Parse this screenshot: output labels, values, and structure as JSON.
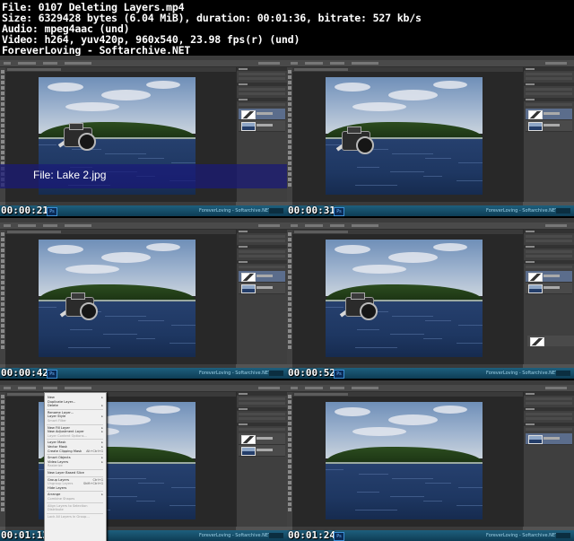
{
  "header": {
    "lines": [
      "File: 0107 Deleting Layers.mp4",
      "Size: 6329428 bytes (6.04 MiB), duration: 00:01:36, bitrate: 527 kb/s",
      "Audio: mpeg4aac (und)",
      "Video: h264, yuv420p, 960x540, 23.98 fps(r) (und)",
      "ForeverLoving - Softarchive.NET"
    ]
  },
  "taskbar_label": "ForeverLoving - Softarchive.NET",
  "ps_icon": "Ps",
  "frames": [
    {
      "timestamp": "00:00:21",
      "banner": "File: Lake 2.jpg"
    },
    {
      "timestamp": "00:00:31"
    },
    {
      "timestamp": "00:00:42"
    },
    {
      "timestamp": "00:00:52"
    },
    {
      "timestamp": "00:01:13"
    },
    {
      "timestamp": "00:01:24"
    }
  ],
  "context_menu": {
    "items": [
      {
        "label": "New",
        "disabled": false,
        "sub": true
      },
      {
        "label": "Duplicate Layer...",
        "disabled": false
      },
      {
        "label": "Delete",
        "disabled": false,
        "sub": true
      },
      {
        "sep": true
      },
      {
        "label": "Rename Layer...",
        "disabled": false
      },
      {
        "label": "Layer Style",
        "disabled": false,
        "sub": true
      },
      {
        "label": "Smart Filter",
        "disabled": true
      },
      {
        "sep": true
      },
      {
        "label": "New Fill Layer",
        "disabled": false,
        "sub": true
      },
      {
        "label": "New Adjustment Layer",
        "disabled": false,
        "sub": true
      },
      {
        "label": "Layer Content Options...",
        "disabled": true
      },
      {
        "sep": true
      },
      {
        "label": "Layer Mask",
        "disabled": false,
        "sub": true
      },
      {
        "label": "Vector Mask",
        "disabled": false,
        "sub": true
      },
      {
        "label": "Create Clipping Mask",
        "disabled": false,
        "shortcut": "Alt+Ctrl+G"
      },
      {
        "sep": true
      },
      {
        "label": "Smart Objects",
        "disabled": false,
        "sub": true
      },
      {
        "label": "Video Layers",
        "disabled": false,
        "sub": true
      },
      {
        "label": "Rasterize",
        "disabled": true
      },
      {
        "sep": true
      },
      {
        "label": "New Layer Based Slice",
        "disabled": false
      },
      {
        "sep": true
      },
      {
        "label": "Group Layers",
        "disabled": false,
        "shortcut": "Ctrl+G"
      },
      {
        "label": "Ungroup Layers",
        "disabled": true,
        "shortcut": "Shift+Ctrl+G"
      },
      {
        "label": "Hide Layers",
        "disabled": false
      },
      {
        "sep": true
      },
      {
        "label": "Arrange",
        "disabled": false,
        "sub": true
      },
      {
        "label": "Combine Shapes",
        "disabled": true
      },
      {
        "sep": true
      },
      {
        "label": "Align Layers to Selection",
        "disabled": true
      },
      {
        "label": "Distribute",
        "disabled": true
      },
      {
        "sep": true
      },
      {
        "label": "Lock All Layers in Group...",
        "disabled": true
      }
    ]
  }
}
